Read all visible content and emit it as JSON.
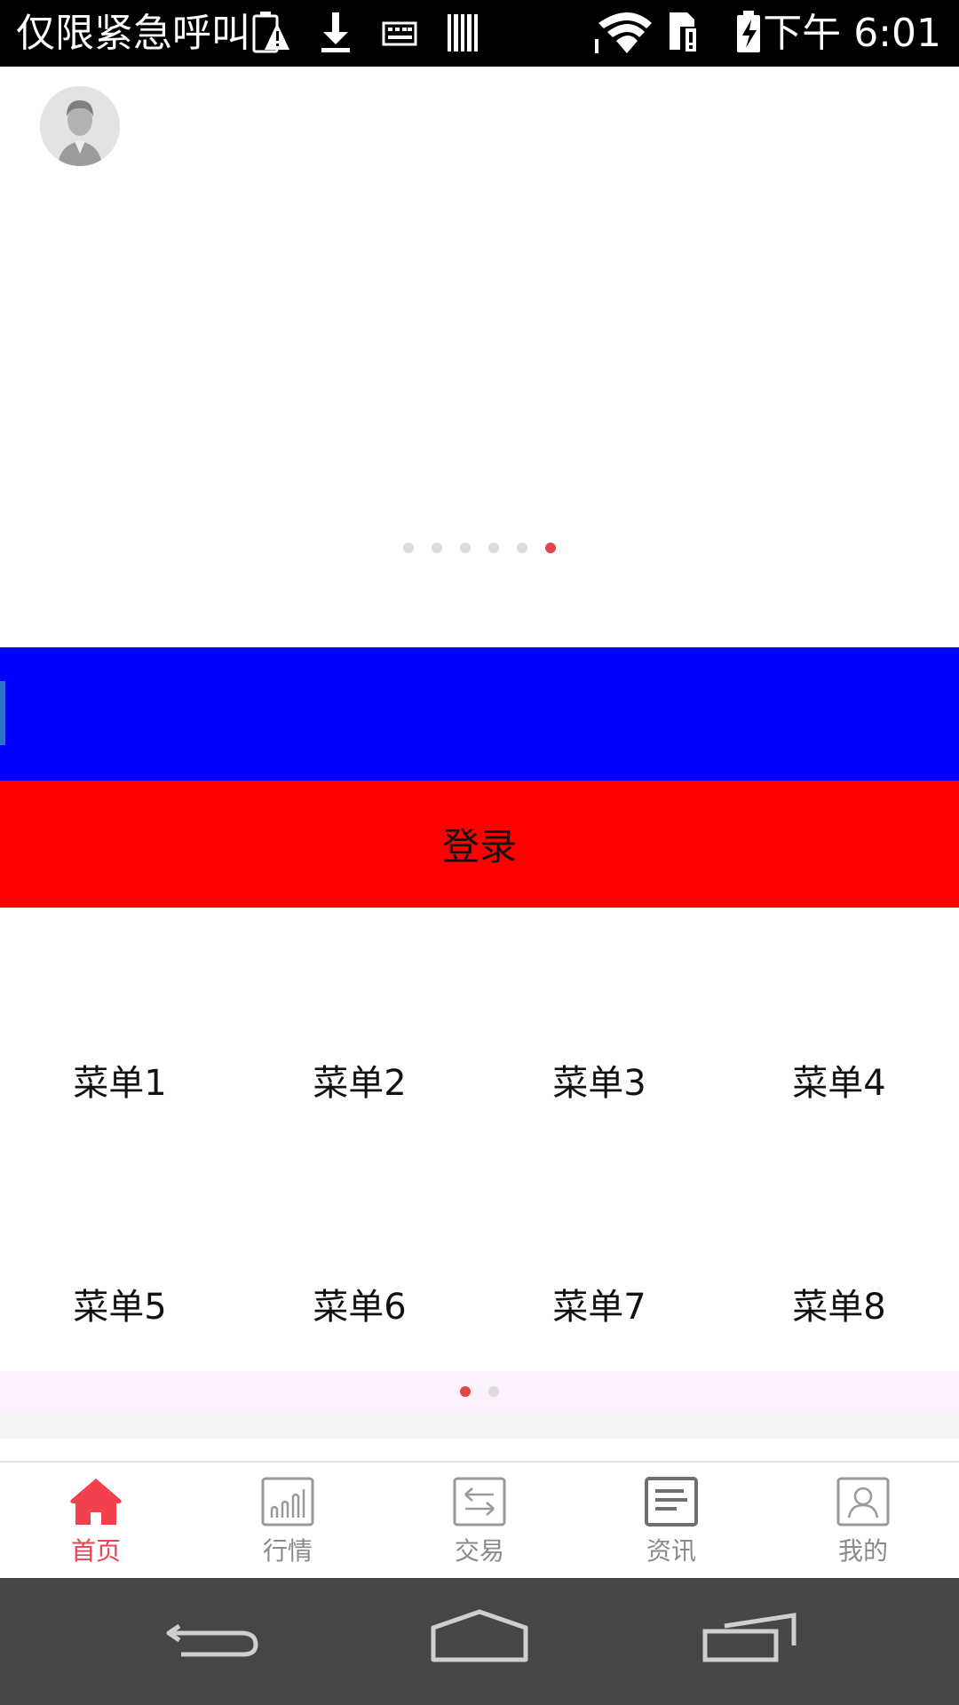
{
  "status_bar": {
    "carrier_text": "仅限紧急呼叫",
    "time_text": "下午 6:01",
    "icons": [
      "battery-alert-icon",
      "download-icon",
      "keyboard-icon",
      "barcode-icon",
      "wifi-icon",
      "sim-alert-icon",
      "battery-charging-icon"
    ]
  },
  "banner": {
    "avatar": "avatar-placeholder-icon",
    "page_count": 6,
    "active_page": 6
  },
  "login": {
    "label": "登录"
  },
  "menu": {
    "items": [
      "菜单1",
      "菜单2",
      "菜单3",
      "菜单4",
      "菜单5",
      "菜单6",
      "菜单7",
      "菜单8"
    ],
    "page_count": 2,
    "active_page": 1
  },
  "tabbar": {
    "tabs": [
      {
        "label": "首页",
        "icon": "home-icon",
        "active": true
      },
      {
        "label": "行情",
        "icon": "market-chart-icon",
        "active": false
      },
      {
        "label": "交易",
        "icon": "trade-exchange-icon",
        "active": false
      },
      {
        "label": "资讯",
        "icon": "news-icon",
        "active": false
      },
      {
        "label": "我的",
        "icon": "profile-icon",
        "active": false
      }
    ]
  },
  "colors": {
    "blue_strip": "#0000ff",
    "login_bg": "#ff0000",
    "accent": "#f2404d",
    "inactive_tab": "#8a8a8a"
  }
}
